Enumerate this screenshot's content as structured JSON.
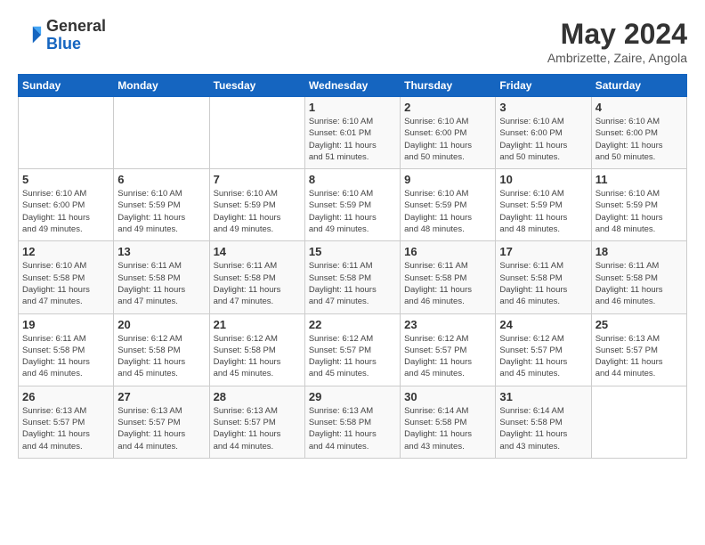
{
  "header": {
    "logo_general": "General",
    "logo_blue": "Blue",
    "month_title": "May 2024",
    "location": "Ambrizette, Zaire, Angola"
  },
  "calendar": {
    "days_of_week": [
      "Sunday",
      "Monday",
      "Tuesday",
      "Wednesday",
      "Thursday",
      "Friday",
      "Saturday"
    ],
    "weeks": [
      [
        {
          "day": "",
          "info": ""
        },
        {
          "day": "",
          "info": ""
        },
        {
          "day": "",
          "info": ""
        },
        {
          "day": "1",
          "info": "Sunrise: 6:10 AM\nSunset: 6:01 PM\nDaylight: 11 hours\nand 51 minutes."
        },
        {
          "day": "2",
          "info": "Sunrise: 6:10 AM\nSunset: 6:00 PM\nDaylight: 11 hours\nand 50 minutes."
        },
        {
          "day": "3",
          "info": "Sunrise: 6:10 AM\nSunset: 6:00 PM\nDaylight: 11 hours\nand 50 minutes."
        },
        {
          "day": "4",
          "info": "Sunrise: 6:10 AM\nSunset: 6:00 PM\nDaylight: 11 hours\nand 50 minutes."
        }
      ],
      [
        {
          "day": "5",
          "info": "Sunrise: 6:10 AM\nSunset: 6:00 PM\nDaylight: 11 hours\nand 49 minutes."
        },
        {
          "day": "6",
          "info": "Sunrise: 6:10 AM\nSunset: 5:59 PM\nDaylight: 11 hours\nand 49 minutes."
        },
        {
          "day": "7",
          "info": "Sunrise: 6:10 AM\nSunset: 5:59 PM\nDaylight: 11 hours\nand 49 minutes."
        },
        {
          "day": "8",
          "info": "Sunrise: 6:10 AM\nSunset: 5:59 PM\nDaylight: 11 hours\nand 49 minutes."
        },
        {
          "day": "9",
          "info": "Sunrise: 6:10 AM\nSunset: 5:59 PM\nDaylight: 11 hours\nand 48 minutes."
        },
        {
          "day": "10",
          "info": "Sunrise: 6:10 AM\nSunset: 5:59 PM\nDaylight: 11 hours\nand 48 minutes."
        },
        {
          "day": "11",
          "info": "Sunrise: 6:10 AM\nSunset: 5:59 PM\nDaylight: 11 hours\nand 48 minutes."
        }
      ],
      [
        {
          "day": "12",
          "info": "Sunrise: 6:10 AM\nSunset: 5:58 PM\nDaylight: 11 hours\nand 47 minutes."
        },
        {
          "day": "13",
          "info": "Sunrise: 6:11 AM\nSunset: 5:58 PM\nDaylight: 11 hours\nand 47 minutes."
        },
        {
          "day": "14",
          "info": "Sunrise: 6:11 AM\nSunset: 5:58 PM\nDaylight: 11 hours\nand 47 minutes."
        },
        {
          "day": "15",
          "info": "Sunrise: 6:11 AM\nSunset: 5:58 PM\nDaylight: 11 hours\nand 47 minutes."
        },
        {
          "day": "16",
          "info": "Sunrise: 6:11 AM\nSunset: 5:58 PM\nDaylight: 11 hours\nand 46 minutes."
        },
        {
          "day": "17",
          "info": "Sunrise: 6:11 AM\nSunset: 5:58 PM\nDaylight: 11 hours\nand 46 minutes."
        },
        {
          "day": "18",
          "info": "Sunrise: 6:11 AM\nSunset: 5:58 PM\nDaylight: 11 hours\nand 46 minutes."
        }
      ],
      [
        {
          "day": "19",
          "info": "Sunrise: 6:11 AM\nSunset: 5:58 PM\nDaylight: 11 hours\nand 46 minutes."
        },
        {
          "day": "20",
          "info": "Sunrise: 6:12 AM\nSunset: 5:58 PM\nDaylight: 11 hours\nand 45 minutes."
        },
        {
          "day": "21",
          "info": "Sunrise: 6:12 AM\nSunset: 5:58 PM\nDaylight: 11 hours\nand 45 minutes."
        },
        {
          "day": "22",
          "info": "Sunrise: 6:12 AM\nSunset: 5:57 PM\nDaylight: 11 hours\nand 45 minutes."
        },
        {
          "day": "23",
          "info": "Sunrise: 6:12 AM\nSunset: 5:57 PM\nDaylight: 11 hours\nand 45 minutes."
        },
        {
          "day": "24",
          "info": "Sunrise: 6:12 AM\nSunset: 5:57 PM\nDaylight: 11 hours\nand 45 minutes."
        },
        {
          "day": "25",
          "info": "Sunrise: 6:13 AM\nSunset: 5:57 PM\nDaylight: 11 hours\nand 44 minutes."
        }
      ],
      [
        {
          "day": "26",
          "info": "Sunrise: 6:13 AM\nSunset: 5:57 PM\nDaylight: 11 hours\nand 44 minutes."
        },
        {
          "day": "27",
          "info": "Sunrise: 6:13 AM\nSunset: 5:57 PM\nDaylight: 11 hours\nand 44 minutes."
        },
        {
          "day": "28",
          "info": "Sunrise: 6:13 AM\nSunset: 5:57 PM\nDaylight: 11 hours\nand 44 minutes."
        },
        {
          "day": "29",
          "info": "Sunrise: 6:13 AM\nSunset: 5:58 PM\nDaylight: 11 hours\nand 44 minutes."
        },
        {
          "day": "30",
          "info": "Sunrise: 6:14 AM\nSunset: 5:58 PM\nDaylight: 11 hours\nand 43 minutes."
        },
        {
          "day": "31",
          "info": "Sunrise: 6:14 AM\nSunset: 5:58 PM\nDaylight: 11 hours\nand 43 minutes."
        },
        {
          "day": "",
          "info": ""
        }
      ]
    ]
  }
}
